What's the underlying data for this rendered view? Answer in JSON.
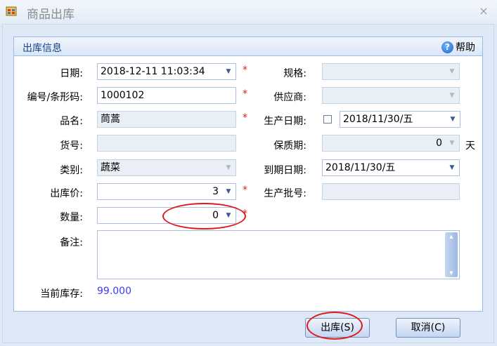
{
  "window": {
    "title": "商品出库",
    "close_glyph": "×"
  },
  "panel": {
    "title": "出库信息",
    "help_label": "帮助"
  },
  "form": {
    "date_label": "日期:",
    "date_value": "2018-12-11 11:03:34",
    "code_label": "编号/条形码:",
    "code_value": "1000102",
    "name_label": "品名:",
    "name_value": "茼蒿",
    "cargo_label": "货号:",
    "cargo_value": "",
    "category_label": "类别:",
    "category_value": "蔬菜",
    "price_label": "出库价:",
    "price_value": "3",
    "qty_label": "数量:",
    "qty_value": "0",
    "remark_label": "备注:",
    "remark_value": "",
    "stock_label": "当前库存:",
    "stock_value": "99.000",
    "spec_label": "规格:",
    "spec_value": "",
    "supplier_label": "供应商:",
    "supplier_value": "",
    "mfg_label": "生产日期:",
    "mfg_value": "2018/11/30/五",
    "shelf_label": "保质期:",
    "shelf_value": "0",
    "shelf_unit": "天",
    "expiry_label": "到期日期:",
    "expiry_value": "2018/11/30/五",
    "batch_label": "生产批号:",
    "batch_value": "",
    "required_mark": "*"
  },
  "buttons": {
    "ok": "出库(S)",
    "cancel": "取消(C)"
  },
  "icons": {
    "app": "app-window-icon",
    "help": "help-icon",
    "dropdown": "chevron-down-icon",
    "spinner": "spinner-icon"
  },
  "colors": {
    "accent": "#15428b",
    "required": "#e02020",
    "stock": "#3a3aff",
    "highlight": "#e01818"
  }
}
